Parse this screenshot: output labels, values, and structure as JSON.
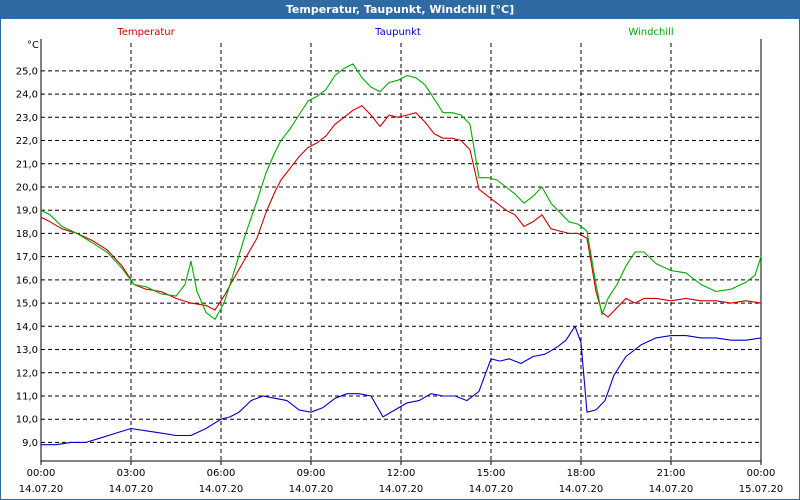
{
  "window": {
    "title": "Temperatur, Taupunkt, Windchill [°C]"
  },
  "chart_data": {
    "type": "line",
    "title": "Temperatur, Taupunkt, Windchill [°C]",
    "ylabel": "°C",
    "xlabel": "",
    "ylim": [
      8.2,
      26.2
    ],
    "xlim": [
      0,
      24
    ],
    "grid": true,
    "legend_position": "top",
    "y_ticks": [
      "9,0",
      "10,0",
      "11,0",
      "12,0",
      "13,0",
      "14,0",
      "15,0",
      "16,0",
      "17,0",
      "18,0",
      "19,0",
      "20,0",
      "21,0",
      "22,0",
      "23,0",
      "24,0",
      "25,0"
    ],
    "x_ticks": [
      {
        "time": "00:00",
        "date": "14.07.20"
      },
      {
        "time": "03:00",
        "date": "14.07.20"
      },
      {
        "time": "06:00",
        "date": "14.07.20"
      },
      {
        "time": "09:00",
        "date": "14.07.20"
      },
      {
        "time": "12:00",
        "date": "14.07.20"
      },
      {
        "time": "15:00",
        "date": "14.07.20"
      },
      {
        "time": "18:00",
        "date": "14.07.20"
      },
      {
        "time": "21:00",
        "date": "14.07.20"
      },
      {
        "time": "00:00",
        "date": "15.07.20"
      }
    ],
    "series": [
      {
        "name": "Temperatur",
        "color": "#cc0000",
        "x": [
          0,
          0.3,
          0.7,
          1.2,
          1.7,
          2.2,
          2.7,
          3.1,
          3.5,
          4.0,
          4.5,
          5.0,
          5.5,
          5.8,
          6.1,
          6.4,
          6.8,
          7.2,
          7.5,
          7.8,
          8.0,
          8.3,
          8.6,
          8.9,
          9.2,
          9.5,
          9.8,
          10.1,
          10.4,
          10.7,
          11.0,
          11.3,
          11.6,
          11.9,
          12.2,
          12.5,
          12.8,
          13.1,
          13.4,
          13.7,
          14.0,
          14.3,
          14.6,
          14.9,
          15.2,
          15.5,
          15.8,
          16.1,
          16.4,
          16.7,
          17.0,
          17.3,
          17.6,
          17.9,
          18.2,
          18.5,
          18.7,
          18.9,
          19.2,
          19.5,
          19.8,
          20.1,
          20.5,
          21.0,
          21.5,
          22.0,
          22.5,
          23.0,
          23.5,
          24.0
        ],
        "values": [
          18.7,
          18.5,
          18.2,
          18.0,
          17.7,
          17.3,
          16.6,
          15.8,
          15.6,
          15.5,
          15.2,
          15.0,
          14.9,
          14.7,
          15.3,
          16.0,
          16.9,
          17.8,
          18.9,
          19.8,
          20.3,
          20.8,
          21.3,
          21.7,
          21.9,
          22.2,
          22.7,
          23.0,
          23.3,
          23.5,
          23.1,
          22.6,
          23.1,
          23.0,
          23.1,
          23.2,
          22.8,
          22.3,
          22.1,
          22.1,
          22.0,
          21.6,
          19.9,
          19.6,
          19.3,
          19.0,
          18.8,
          18.3,
          18.5,
          18.8,
          18.2,
          18.1,
          18.0,
          18.0,
          17.8,
          15.5,
          14.6,
          14.4,
          14.8,
          15.2,
          15.0,
          15.2,
          15.2,
          15.1,
          15.2,
          15.1,
          15.1,
          15.0,
          15.1,
          15.0
        ]
      },
      {
        "name": "Taupunkt",
        "color": "#0000cc",
        "x": [
          0,
          0.5,
          1.0,
          1.5,
          2.0,
          2.5,
          3.0,
          3.5,
          4.0,
          4.5,
          5.0,
          5.5,
          6.0,
          6.3,
          6.6,
          7.0,
          7.4,
          7.8,
          8.2,
          8.6,
          9.0,
          9.4,
          9.8,
          10.2,
          10.6,
          11.0,
          11.4,
          11.8,
          12.2,
          12.6,
          13.0,
          13.4,
          13.8,
          14.2,
          14.6,
          15.0,
          15.3,
          15.6,
          16.0,
          16.4,
          16.8,
          17.2,
          17.5,
          17.8,
          18.0,
          18.2,
          18.5,
          18.8,
          19.1,
          19.5,
          20.0,
          20.5,
          21.0,
          21.5,
          22.0,
          22.5,
          23.0,
          23.5,
          24.0
        ],
        "values": [
          8.9,
          8.9,
          9.0,
          9.0,
          9.2,
          9.4,
          9.6,
          9.5,
          9.4,
          9.3,
          9.3,
          9.6,
          10.0,
          10.1,
          10.3,
          10.8,
          11.0,
          10.9,
          10.8,
          10.4,
          10.3,
          10.5,
          10.9,
          11.1,
          11.1,
          11.0,
          10.1,
          10.4,
          10.7,
          10.8,
          11.1,
          11.0,
          11.0,
          10.8,
          11.2,
          12.6,
          12.5,
          12.6,
          12.4,
          12.7,
          12.8,
          13.1,
          13.4,
          14.0,
          13.3,
          10.3,
          10.4,
          10.8,
          11.9,
          12.7,
          13.2,
          13.5,
          13.6,
          13.6,
          13.5,
          13.5,
          13.4,
          13.4,
          13.5
        ]
      },
      {
        "name": "Windchill",
        "color": "#00aa00",
        "x": [
          0,
          0.3,
          0.7,
          1.2,
          1.7,
          2.2,
          2.7,
          3.1,
          3.5,
          4.0,
          4.5,
          4.8,
          5.0,
          5.2,
          5.5,
          5.8,
          6.1,
          6.4,
          6.8,
          7.2,
          7.5,
          7.8,
          8.0,
          8.3,
          8.6,
          8.9,
          9.2,
          9.5,
          9.8,
          10.1,
          10.4,
          10.7,
          11.0,
          11.3,
          11.6,
          11.9,
          12.2,
          12.5,
          12.8,
          13.1,
          13.4,
          13.7,
          14.0,
          14.3,
          14.6,
          14.9,
          15.2,
          15.5,
          15.8,
          16.1,
          16.4,
          16.7,
          17.0,
          17.3,
          17.6,
          17.9,
          18.2,
          18.5,
          18.7,
          18.9,
          19.2,
          19.5,
          19.8,
          20.1,
          20.5,
          21.0,
          21.5,
          22.0,
          22.5,
          23.0,
          23.5,
          23.8,
          24.0
        ],
        "values": [
          19.0,
          18.8,
          18.3,
          18.0,
          17.6,
          17.2,
          16.5,
          15.8,
          15.7,
          15.4,
          15.3,
          15.8,
          16.8,
          15.5,
          14.6,
          14.3,
          15.0,
          16.2,
          17.9,
          19.4,
          20.6,
          21.5,
          22.0,
          22.5,
          23.1,
          23.7,
          23.9,
          24.2,
          24.8,
          25.1,
          25.3,
          24.7,
          24.3,
          24.1,
          24.5,
          24.6,
          24.8,
          24.7,
          24.4,
          23.8,
          23.2,
          23.2,
          23.1,
          22.7,
          20.4,
          20.4,
          20.3,
          20.0,
          19.7,
          19.3,
          19.6,
          20.0,
          19.3,
          18.9,
          18.5,
          18.4,
          18.1,
          15.8,
          14.5,
          15.2,
          15.8,
          16.6,
          17.2,
          17.2,
          16.7,
          16.4,
          16.3,
          15.8,
          15.5,
          15.6,
          15.9,
          16.2,
          17.0
        ]
      }
    ]
  }
}
